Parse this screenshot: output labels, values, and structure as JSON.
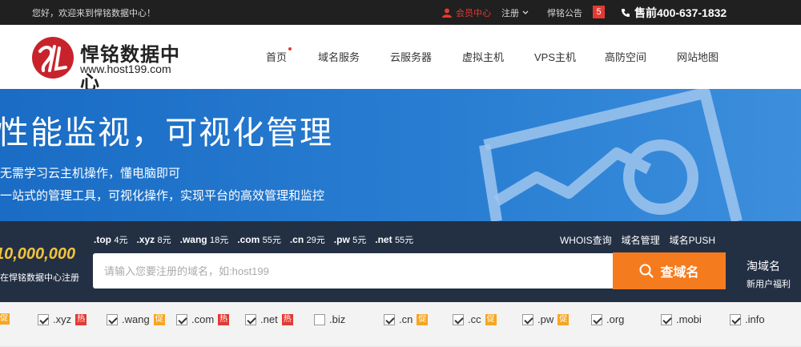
{
  "topbar": {
    "welcome": "您好，欢迎来到悍铭数据中心！",
    "member": "会员中心",
    "register": "注册",
    "announce": "悍铭公告",
    "badge": "5",
    "hotline": "售前400-637-1832"
  },
  "logo": {
    "name": "悍铭数据中心",
    "site": "www.host199.com"
  },
  "nav": [
    "首页",
    "域名服务",
    "云服务器",
    "虚拟主机",
    "VPS主机",
    "高防空间",
    "网站地图"
  ],
  "banner": {
    "headline": "性能监视，可视化管理",
    "sub1": "无需学习云主机操作，懂电脑即可",
    "sub2": "一站式的管理工具，可视化操作，实现平台的高效管理和监控"
  },
  "promo": {
    "big": "10,000,000",
    "small": "在悍铭数据中心注册"
  },
  "tld_prices": [
    {
      "tld": ".top",
      "price": "4元"
    },
    {
      "tld": ".xyz",
      "price": "8元"
    },
    {
      "tld": ".wang",
      "price": "18元"
    },
    {
      "tld": ".com",
      "price": "55元"
    },
    {
      "tld": ".cn",
      "price": "29元"
    },
    {
      "tld": ".pw",
      "price": "5元"
    },
    {
      "tld": ".net",
      "price": "55元"
    }
  ],
  "links": [
    "WHOIS查询",
    "域名管理",
    "域名PUSH"
  ],
  "search": {
    "placeholder": "请输入您要注册的域名，如:host199",
    "button": "查域名"
  },
  "side_promo": {
    "t1": "淘域名",
    "t2": "新用户福利"
  },
  "tld_checks": [
    {
      "name": "top",
      "label": "",
      "checked": false,
      "tag": "促",
      "tag_type": "cu"
    },
    {
      "name": "xyz",
      "label": ".xyz",
      "checked": true,
      "tag": "热",
      "tag_type": "hot"
    },
    {
      "name": "wang",
      "label": ".wang",
      "checked": true,
      "tag": "促",
      "tag_type": "cu"
    },
    {
      "name": "com",
      "label": ".com",
      "checked": true,
      "tag": "热",
      "tag_type": "hot"
    },
    {
      "name": "net",
      "label": ".net",
      "checked": true,
      "tag": "热",
      "tag_type": "hot"
    },
    {
      "name": "biz",
      "label": ".biz",
      "checked": false,
      "tag": "",
      "tag_type": ""
    },
    {
      "name": "cn",
      "label": ".cn",
      "checked": true,
      "tag": "促",
      "tag_type": "cu"
    },
    {
      "name": "cc",
      "label": ".cc",
      "checked": true,
      "tag": "促",
      "tag_type": "cu"
    },
    {
      "name": "pw",
      "label": ".pw",
      "checked": true,
      "tag": "促",
      "tag_type": "cu"
    },
    {
      "name": "org",
      "label": ".org",
      "checked": true,
      "tag": "",
      "tag_type": ""
    },
    {
      "name": "mobi",
      "label": ".mobi",
      "checked": true,
      "tag": "",
      "tag_type": ""
    },
    {
      "name": "info",
      "label": ".info",
      "checked": true,
      "tag": "",
      "tag_type": ""
    }
  ],
  "colors": {
    "accent": "#e23a32",
    "search_button": "#f57b1f",
    "banner": "#2a7fd3",
    "band": "#233044"
  }
}
